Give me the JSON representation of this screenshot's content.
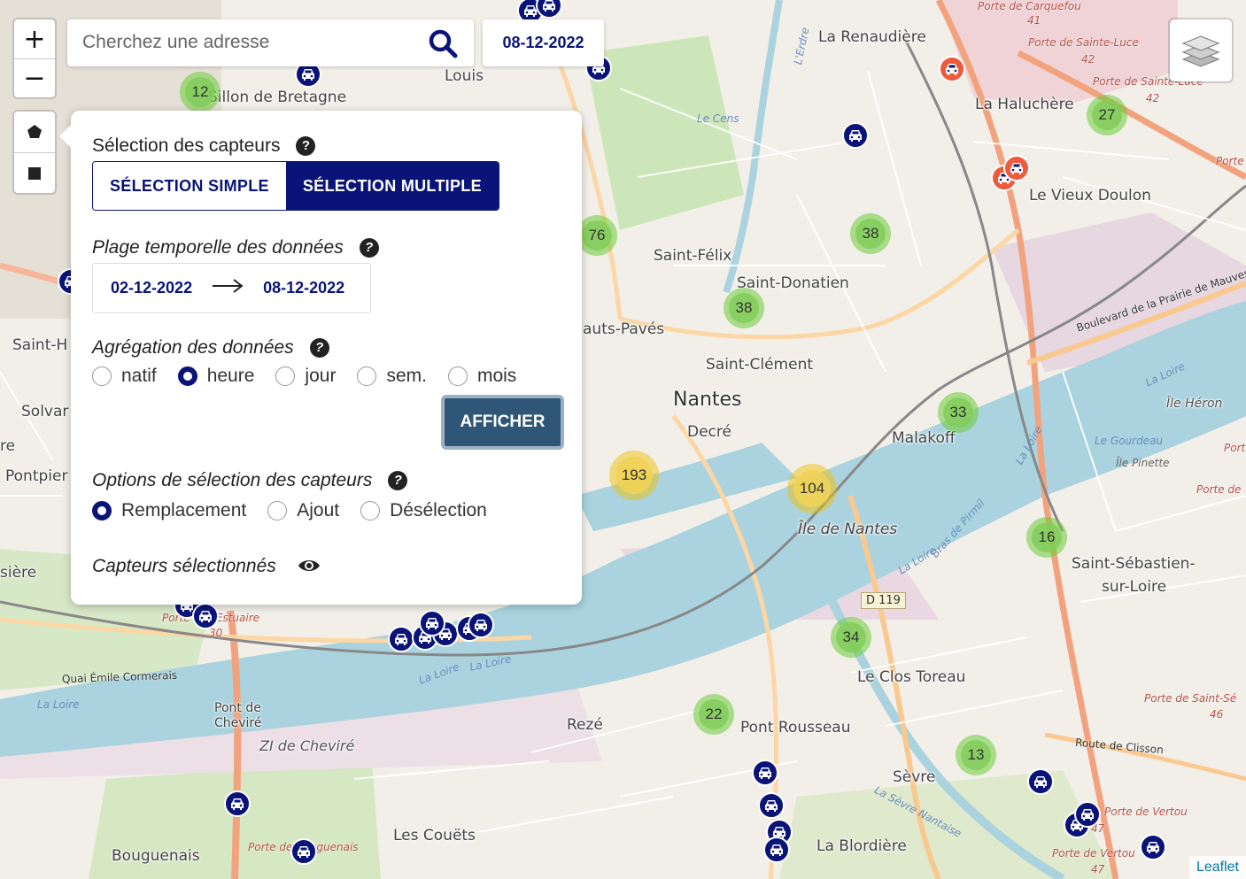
{
  "search": {
    "placeholder": "Cherchez une adresse"
  },
  "current_date": "08-12-2022",
  "controls": {
    "zoom_in": "+",
    "zoom_out": "−"
  },
  "attribution": "Leaflet",
  "panel": {
    "sensor_selection": {
      "title": "Sélection des capteurs",
      "simple_label": "SÉLECTION SIMPLE",
      "multiple_label": "SÉLECTION MULTIPLE",
      "active": "multiple"
    },
    "time_range": {
      "title": "Plage temporelle des données",
      "start": "02-12-2022",
      "end": "08-12-2022"
    },
    "aggregation": {
      "title": "Agrégation des données",
      "options": [
        "natif",
        "heure",
        "jour",
        "sem.",
        "mois"
      ],
      "selected": "heure"
    },
    "show_button": "AFFICHER",
    "selection_options": {
      "title": "Options de sélection des capteurs",
      "options": [
        "Remplacement",
        "Ajout",
        "Désélection"
      ],
      "selected": "Remplacement"
    },
    "selected_sensors": {
      "title": "Capteurs sélectionnés"
    }
  },
  "map": {
    "places": [
      "La Renaudière",
      "La Haluchère",
      "Le Vieux Doulon",
      "Saint-Félix",
      "Saint-Donatien",
      "Saint-Clément",
      "Nantes",
      "Decré",
      "Malakoff",
      "Île de Nantes",
      "Saint-Sébastien-",
      "sur-Loire",
      "Le Clos Toreau",
      "Rezé",
      "Pont Rousseau",
      "Sèvre",
      "La Blordière",
      "Les Couëts",
      "Bouguenais",
      "ZI de Cheviré",
      "Pont de",
      "Cheviré",
      "Louis",
      "Sillon de Bretagne",
      "Saint-H",
      "Solvar",
      "Pontpier",
      "sière",
      "re",
      "auts-Pavés",
      "Île Héron",
      "Le Gourdeau",
      "Île Pinette"
    ],
    "roads": [
      "Boulevard de la Prairie de Mauves",
      "Route de Clisson",
      "Quai Émile Cormerais",
      "D 119"
    ],
    "gates": [
      "Porte de Sainte-Luce",
      "Porte de Sainte-Luce",
      "Porte de Carquefou",
      "Porte de Saint-Sé",
      "Porte de Vertou",
      "Porte de Vertou",
      "Porte de Bouguenais",
      "Porte de l'Estuaire",
      "Porte",
      "Porte de",
      "Port"
    ],
    "gate_numbers": [
      "41",
      "42",
      "42",
      "46",
      "47",
      "47",
      "30"
    ],
    "water": [
      "La Loire",
      "La Loire",
      "La Loire",
      "La Loire",
      "La Loire",
      "La Sèvre Nantaise",
      "Bras de Pirmil",
      "Le Cens",
      "L'Erdre",
      "La Loire"
    ],
    "clusters": [
      {
        "count": "12",
        "color": "green"
      },
      {
        "count": "76",
        "color": "green"
      },
      {
        "count": "38",
        "color": "green"
      },
      {
        "count": "38",
        "color": "green"
      },
      {
        "count": "27",
        "color": "green"
      },
      {
        "count": "33",
        "color": "green"
      },
      {
        "count": "193",
        "color": "yellow"
      },
      {
        "count": "104",
        "color": "yellow"
      },
      {
        "count": "16",
        "color": "green"
      },
      {
        "count": "34",
        "color": "green"
      },
      {
        "count": "22",
        "color": "green"
      },
      {
        "count": "13",
        "color": "green"
      }
    ],
    "colors": {
      "primary": "#0a1478",
      "cluster_green": "#6ecc39",
      "cluster_yellow": "#f0c20c",
      "marker_orange": "#ef5a3c",
      "water": "#aad3df",
      "button": "#2f5676"
    }
  }
}
